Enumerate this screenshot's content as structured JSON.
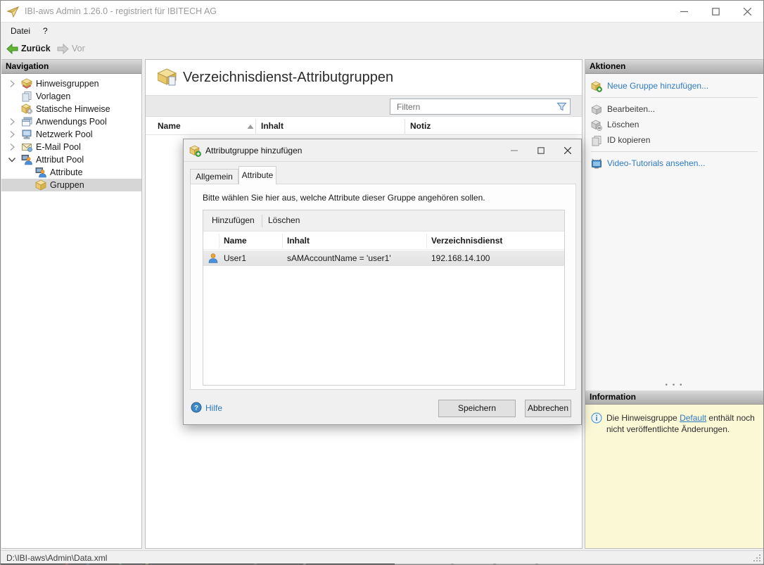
{
  "window": {
    "title": "IBI-aws Admin 1.26.0 - registriert für IBITECH AG"
  },
  "menu": {
    "file": "Datei",
    "help": "?"
  },
  "toolbar": {
    "back": "Zurück",
    "forward": "Vor"
  },
  "sidebar": {
    "header": "Navigation",
    "items": [
      {
        "label": "Hinweisgruppen"
      },
      {
        "label": "Vorlagen"
      },
      {
        "label": "Statische Hinweise"
      },
      {
        "label": "Anwendungs Pool"
      },
      {
        "label": "Netzwerk Pool"
      },
      {
        "label": "E-Mail Pool"
      },
      {
        "label": "Attribut Pool"
      },
      {
        "label": "Attribute"
      },
      {
        "label": "Gruppen"
      }
    ]
  },
  "main": {
    "title": "Verzeichnisdienst-Attributgruppen",
    "filter_placeholder": "Filtern",
    "columns": [
      "Name",
      "Inhalt",
      "Notiz"
    ]
  },
  "dialog": {
    "title": "Attributgruppe hinzufügen",
    "tabs": [
      "Allgemein",
      "Attribute"
    ],
    "instruction": "Bitte wählen Sie hier aus, welche Attribute dieser Gruppe angehören sollen.",
    "toolbar": {
      "add": "Hinzufügen",
      "delete": "Löschen"
    },
    "columns": [
      "Name",
      "Inhalt",
      "Verzeichnisdienst"
    ],
    "rows": [
      {
        "name": "User1",
        "inhalt": "sAMAccountName = 'user1'",
        "verzeichnisdienst": "192.168.14.100"
      }
    ],
    "help": "Hilfe",
    "save": "Speichern",
    "cancel": "Abbrechen"
  },
  "actions": {
    "header": "Aktionen",
    "items": [
      {
        "label": "Neue Gruppe hinzufügen..."
      },
      {
        "label": "Bearbeiten..."
      },
      {
        "label": "Löschen"
      },
      {
        "label": "ID kopieren"
      },
      {
        "label": "Video-Tutorials ansehen..."
      }
    ]
  },
  "information": {
    "header": "Information",
    "text_before": "Die Hinweisgruppe ",
    "link": "Default",
    "text_after": " enthält noch nicht veröffentlichte Änderungen."
  },
  "statusbar": {
    "path": "D:\\IBI-aws\\Admin\\Data.xml"
  }
}
